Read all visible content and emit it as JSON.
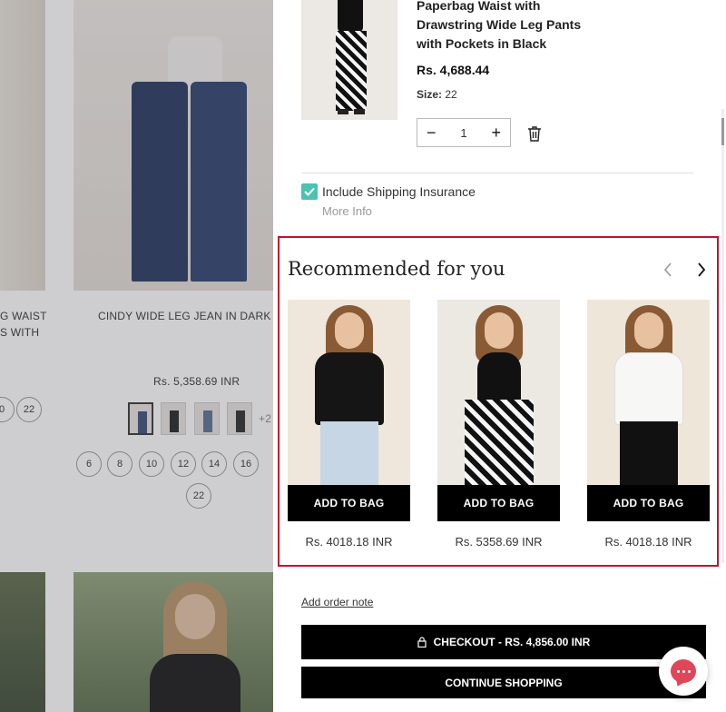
{
  "background": {
    "product_left_name_line1": "G WAIST",
    "product_left_name_line2": "S WITH",
    "product_mid_name": "CINDY WIDE LEG JEAN IN DARK D",
    "product_mid_price": "Rs. 5,358.69 INR",
    "swatch_more": "+2",
    "left_sizes": [
      "0",
      "22"
    ],
    "mid_sizes": [
      "6",
      "8",
      "10",
      "12",
      "14",
      "16",
      "22"
    ]
  },
  "cart_item": {
    "title": "Paperbag Waist with Drawstring Wide Leg Pants with Pockets in Black",
    "price": "Rs. 4,688.44",
    "size_label": "Size:",
    "size_value": "22",
    "quantity": "1",
    "minus": "−",
    "plus": "+"
  },
  "insurance": {
    "label": "Include Shipping Insurance",
    "more_info": "More Info",
    "checked": true
  },
  "recommendations": {
    "title": "Recommended for you",
    "items": [
      {
        "add_label": "ADD TO BAG",
        "price": "Rs. 4018.18 INR"
      },
      {
        "add_label": "ADD TO BAG",
        "price": "Rs. 5358.69 INR"
      },
      {
        "add_label": "ADD TO BAG",
        "price": "Rs. 4018.18 INR"
      }
    ]
  },
  "footer": {
    "order_note": "Add order note",
    "checkout": "CHECKOUT - RS. 4,856.00 INR",
    "continue": "CONTINUE SHOPPING"
  },
  "colors": {
    "accent_red": "#c8102e",
    "checkbox": "#4cc2b0",
    "chat": "#e0465a"
  }
}
